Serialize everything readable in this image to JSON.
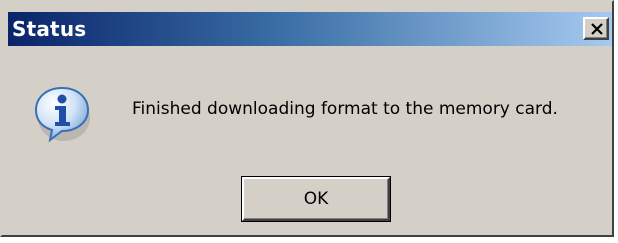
{
  "window": {
    "title": "Status",
    "close_icon": "close-icon",
    "titlebar_colors": [
      "#0a246a",
      "#a6caf0"
    ],
    "background": "#d4d0c8"
  },
  "content": {
    "icon": "info-icon",
    "message": "Finished downloading format to the memory card."
  },
  "buttons": {
    "ok_label": "OK"
  }
}
